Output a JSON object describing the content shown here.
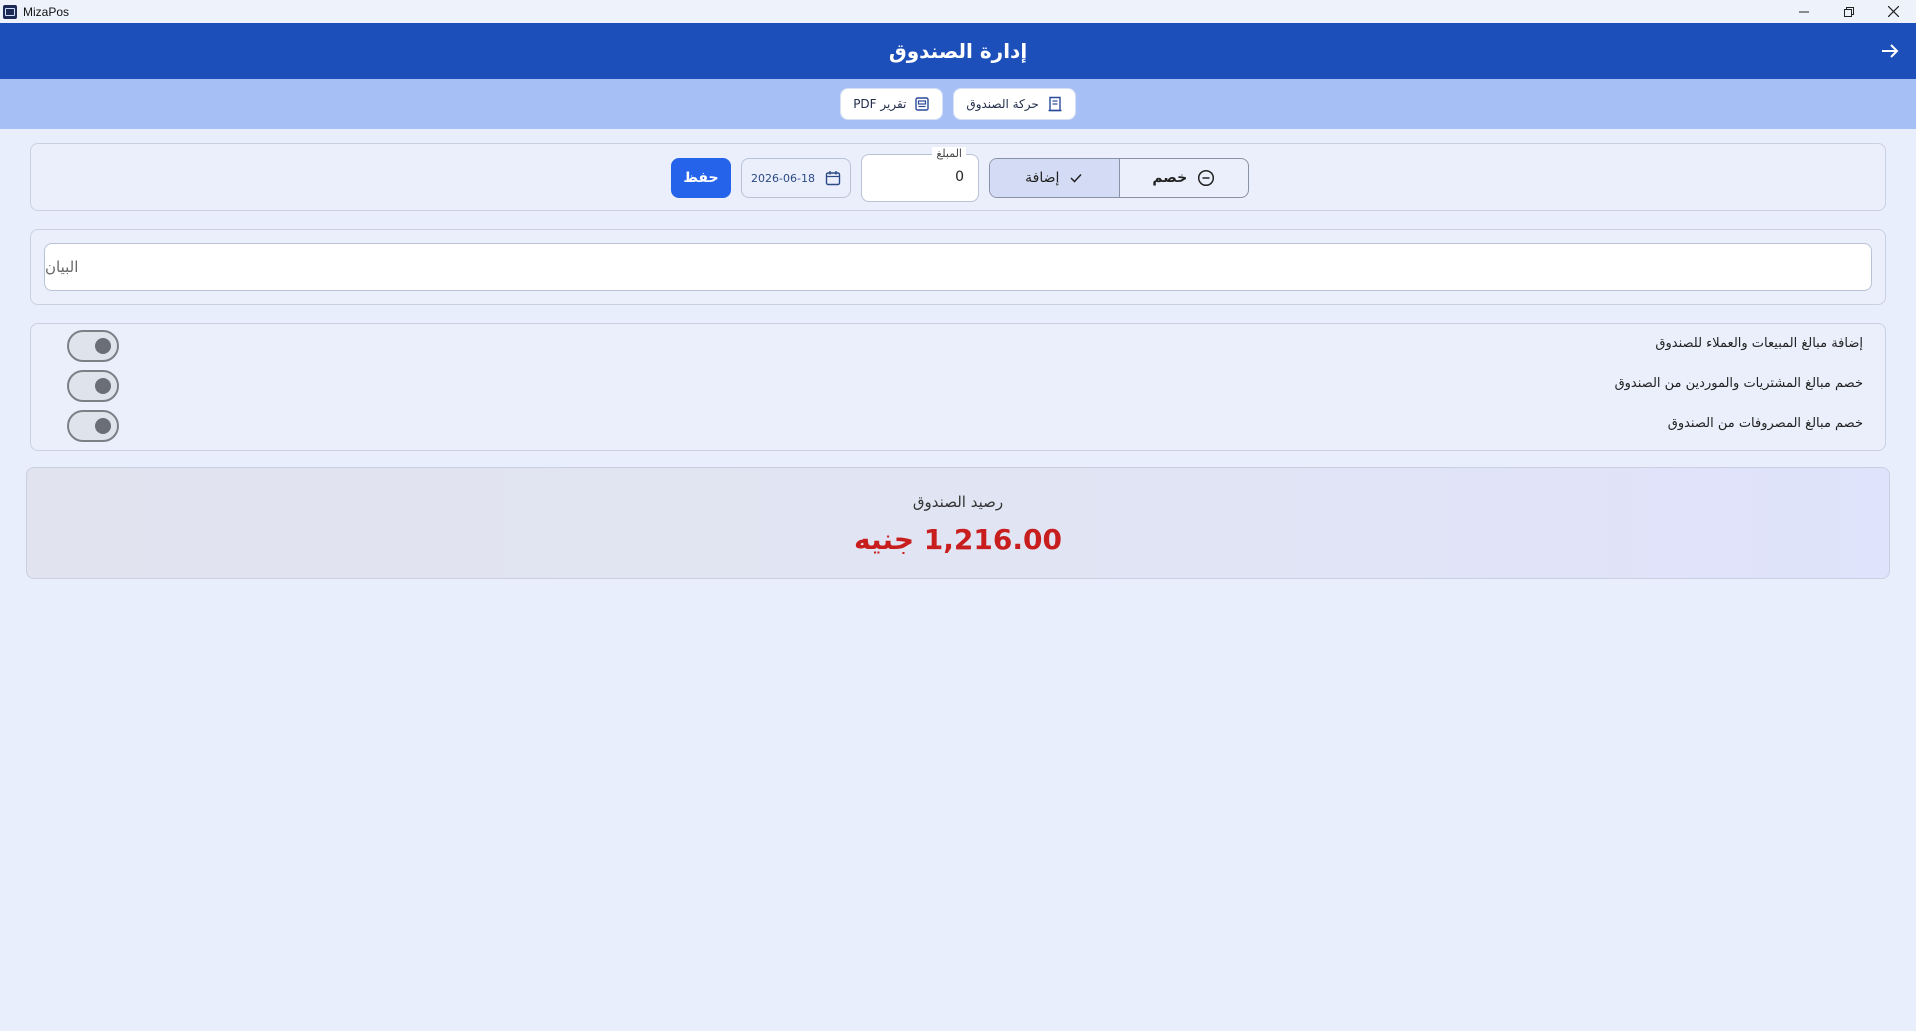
{
  "window": {
    "app_name": "MizaPos"
  },
  "header": {
    "title": "إدارة الصندوق"
  },
  "toolbar": {
    "cash_movement_label": "حركة الصندوق",
    "pdf_report_label": "تقرير PDF"
  },
  "entry": {
    "type_options": [
      {
        "label": "خصم",
        "selected": false
      },
      {
        "label": "إضافة",
        "selected": true
      }
    ],
    "amount_label": "المبلغ",
    "amount_value": "0",
    "date_value": "2026-06-18",
    "save_label": "حفظ"
  },
  "description": {
    "placeholder": "البيان"
  },
  "toggles": [
    {
      "label": "إضافة مبالغ المبيعات والعملاء للصندوق"
    },
    {
      "label": "خصم مبالغ المشتريات والموردين من الصندوق"
    },
    {
      "label": "خصم مبالغ المصروفات من الصندوق"
    }
  ],
  "balance": {
    "title": "رصيد الصندوق",
    "value": "1,216.00 جنيه"
  },
  "colors": {
    "header": "#1d4fba",
    "subbar": "#a6bff5",
    "primary_button": "#2563eb",
    "balance_text": "#c81e1e"
  }
}
